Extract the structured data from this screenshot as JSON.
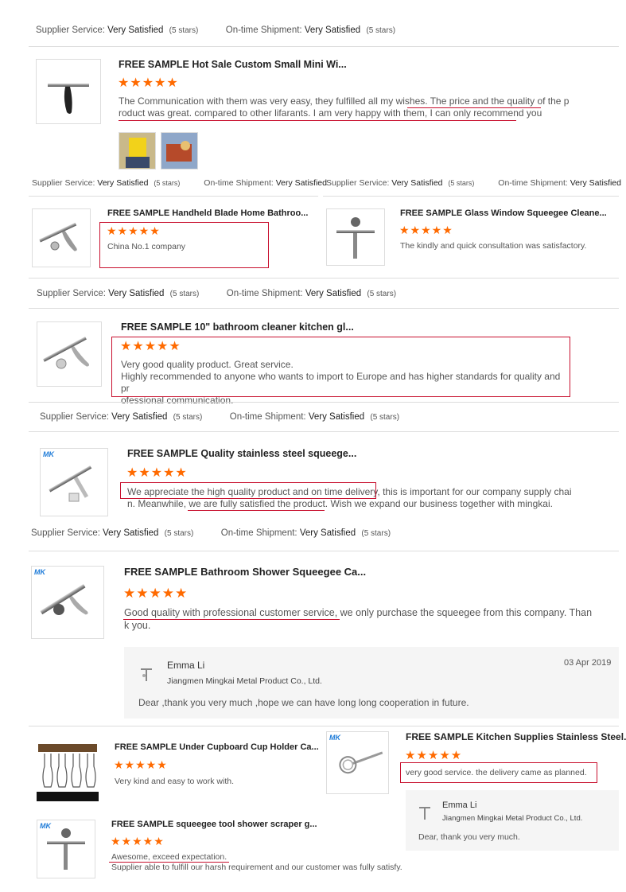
{
  "rating_labels": {
    "supplier_service": "Supplier Service:",
    "ontime_shipment": "On-time Shipment:",
    "value": "Very Satisfied",
    "stars_note": "(5 stars)"
  },
  "star_glyphs": "★★★★★",
  "brand_mark": "MK",
  "reviews": [
    {
      "title": "FREE SAMPLE Hot Sale Custom Small Mini Wi...",
      "text_line1": "The Communication with them was very easy, they fulfilled all my wishes. The price and the quality of the p",
      "text_line2": "roduct was great. compared to other lifarants. I am very happy with them, I can only recommend you"
    },
    {
      "title": "FREE SAMPLE Handheld Blade Home Bathroo...",
      "text": "China No.1 company"
    },
    {
      "title": "FREE SAMPLE Glass Window Squeegee Cleane...",
      "text": "The kindly and quick consultation was satisfactory."
    },
    {
      "title": "FREE SAMPLE 10\" bathroom cleaner kitchen gl...",
      "text_line1": "Very good quality product. Great service.",
      "text_line2": "Highly recommended to anyone who wants to import to Europe and has higher standards for quality and pr",
      "text_line3": "ofessional communication."
    },
    {
      "title": "FREE SAMPLE Quality stainless steel squeege...",
      "text_line1": "We appreciate the high quality product and on time delivery, this is important for our company supply chai",
      "text_line2": "n. Meanwhile,  we are fully satisfied the product. Wish we expand our business together with mingkai."
    },
    {
      "title": "FREE SAMPLE Bathroom Shower Squeegee Ca...",
      "text_line1": "Good quality with professional customer service, we only purchase the squeegee from this company. Than",
      "text_line2": "k you."
    },
    {
      "title": "FREE SAMPLE Under Cupboard Cup Holder Ca...",
      "text": "Very kind and easy to work with."
    },
    {
      "title": "FREE SAMPLE Kitchen Supplies Stainless Steel...",
      "text": "very good service. the delivery came as planned."
    },
    {
      "title": "FREE SAMPLE squeegee tool shower scraper g...",
      "text_line1": "Awesome, exceed expectation.",
      "text_line2": "Supplier able to fulfill our harsh requirement and our customer was fully satisfy."
    }
  ],
  "replies": [
    {
      "name": "Emma Li",
      "company": "Jiangmen Mingkai Metal Product Co., Ltd.",
      "date": "03 Apr 2019",
      "text": "Dear ,thank you very much ,hope we can have long long cooperation in future."
    },
    {
      "name": "Emma Li",
      "company": "Jiangmen Mingkai Metal Product Co., Ltd.",
      "text": "Dear, thank you very much."
    }
  ]
}
